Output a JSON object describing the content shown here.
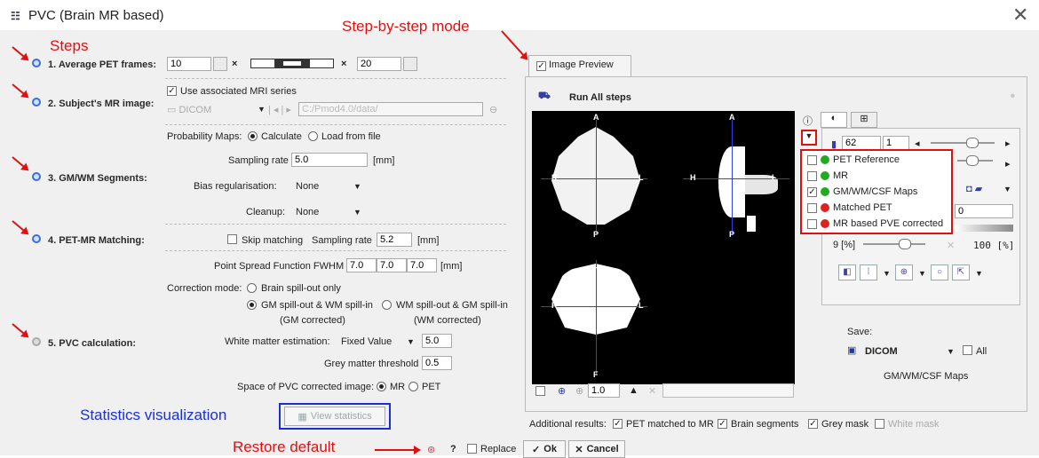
{
  "window": {
    "title": "PVC (Brain MR based)",
    "close": "✕"
  },
  "annotations": {
    "steps": "Steps",
    "step_by_step": "Step-by-step mode",
    "statistics_vis": "Statistics visualization",
    "restore_default": "Restore default"
  },
  "steps": [
    {
      "label": "1. Average PET frames:"
    },
    {
      "label": "2. Subject's MR image:"
    },
    {
      "label": "3. GM/WM Segments:"
    },
    {
      "label": "4. PET-MR Matching:"
    },
    {
      "label": "5. PVC calculation:"
    }
  ],
  "step1": {
    "start": "10",
    "times": "×",
    "end": "20"
  },
  "step2": {
    "use_assoc": "Use associated MRI series",
    "format": "DICOM",
    "path": "C:/Pmod4.0/data/"
  },
  "step3": {
    "prob_maps": "Probability Maps:",
    "calculate": "Calculate",
    "load": "Load from file",
    "sampling_label": "Sampling rate",
    "sampling": "5.0",
    "unit": "[mm]",
    "bias_label": "Bias regularisation:",
    "bias": "None",
    "cleanup_label": "Cleanup:",
    "cleanup": "None"
  },
  "step4": {
    "skip": "Skip matching",
    "sampling_label": "Sampling rate",
    "sampling": "5.2",
    "unit": "[mm]"
  },
  "step5": {
    "psf_label": "Point Spread Function FWHM",
    "psf": [
      "7.0",
      "7.0",
      "7.0"
    ],
    "unit": "[mm]",
    "mode_label": "Correction mode:",
    "mode1": "Brain spill-out only",
    "mode2": "GM spill-out & WM spill-in",
    "mode3": "WM spill-out & GM spill-in",
    "mode2_sub": "(GM corrected)",
    "mode3_sub": "(WM corrected)",
    "wm_label": "White matter estimation:",
    "wm_mode": "Fixed Value",
    "wm_value": "5.0",
    "gm_label": "Grey matter threshold",
    "gm_value": "0.5",
    "space_label": "Space of PVC corrected image:",
    "mr": "MR",
    "pet": "PET"
  },
  "view_stats": "View statistics",
  "footer": {
    "help": "?",
    "replace": "Replace",
    "ok": "Ok",
    "cancel": "Cancel"
  },
  "preview": {
    "tab": "Image Preview",
    "run_all": "Run All steps",
    "zoom": "1.0",
    "slice": "62",
    "slice2": "1",
    "lut_min": "9 [%]",
    "lut_max": "100 [%]",
    "lut_field": "0",
    "save_label": "Save:",
    "save_format": "DICOM",
    "save_all": "All",
    "save_target": "GM/WM/CSF Maps"
  },
  "overlays": [
    {
      "label": "PET Reference",
      "color": "#22aa22",
      "checked": false
    },
    {
      "label": "MR",
      "color": "#22aa22",
      "checked": false
    },
    {
      "label": "GM/WM/CSF Maps",
      "color": "#22aa22",
      "checked": true
    },
    {
      "label": "Matched PET",
      "color": "#dd2222",
      "checked": false
    },
    {
      "label": "MR based PVE corrected",
      "color": "#dd2222",
      "checked": false
    }
  ],
  "additional": {
    "label": "Additional results:",
    "pet_mr": "PET matched to MR",
    "brain_seg": "Brain segments",
    "grey": "Grey mask",
    "white": "White mask"
  },
  "orientation": {
    "A": "A",
    "P": "P",
    "R": "R",
    "L": "L",
    "H": "H",
    "F": "F"
  }
}
